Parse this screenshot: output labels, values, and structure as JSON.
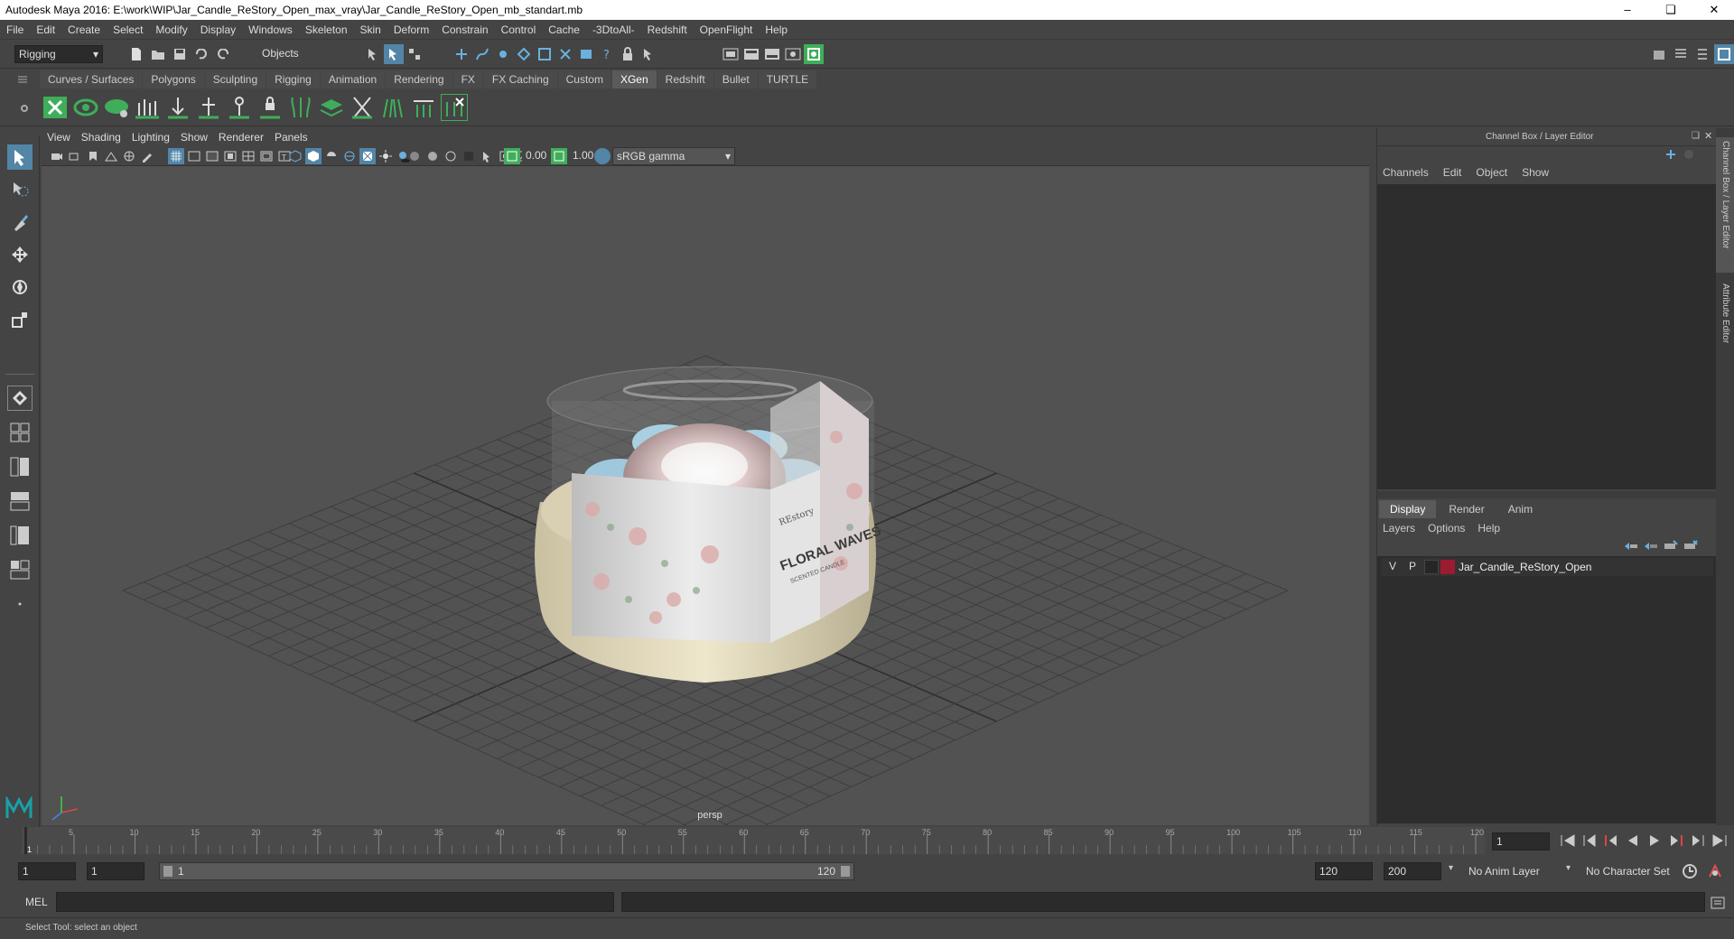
{
  "window": {
    "title": "Autodesk Maya 2016: E:\\work\\WIP\\Jar_Candle_ReStory_Open_max_vray\\Jar_Candle_ReStory_Open_mb_standart.mb"
  },
  "menubar": [
    "File",
    "Edit",
    "Create",
    "Select",
    "Modify",
    "Display",
    "Windows",
    "Skeleton",
    "Skin",
    "Deform",
    "Constrain",
    "Control",
    "Cache",
    "-3DtoAll-",
    "Redshift",
    "OpenFlight",
    "Help"
  ],
  "statusline": {
    "mode": "Rigging",
    "selection_mode": "Objects"
  },
  "shelf_tabs": [
    "Curves / Surfaces",
    "Polygons",
    "Sculpting",
    "Rigging",
    "Animation",
    "Rendering",
    "FX",
    "FX Caching",
    "Custom",
    "XGen",
    "Redshift",
    "Bullet",
    "TURTLE"
  ],
  "active_shelf_tab": "XGen",
  "viewport": {
    "menu": [
      "View",
      "Shading",
      "Lighting",
      "Show",
      "Renderer",
      "Panels"
    ],
    "exposure": "0.00",
    "gamma": "1.00",
    "color_space": "sRGB gamma",
    "camera": "persp",
    "label_brand": "REstory",
    "label_title": "FLORAL WAVES",
    "label_sub": "SCENTED CANDLE"
  },
  "channel_box": {
    "title": "Channel Box / Layer Editor",
    "menu": [
      "Channels",
      "Edit",
      "Object",
      "Show"
    ],
    "layer_tabs": [
      "Display",
      "Render",
      "Anim"
    ],
    "active_layer_tab": "Display",
    "layer_menu": [
      "Layers",
      "Options",
      "Help"
    ],
    "layers": [
      {
        "v": "V",
        "p": "P",
        "name": "Jar_Candle_ReStory_Open",
        "color": "#9b1b30"
      }
    ]
  },
  "side_tabs": [
    "Channel Box / Layer Editor",
    "Attribute Editor"
  ],
  "timeline": {
    "ticks": [
      "1",
      "5",
      "10",
      "15",
      "20",
      "25",
      "30",
      "35",
      "40",
      "45",
      "50",
      "55",
      "60",
      "65",
      "70",
      "75",
      "80",
      "85",
      "90",
      "95",
      "100",
      "105",
      "110",
      "115",
      "120"
    ],
    "current_frame": "1"
  },
  "range": {
    "start": "1",
    "playback_start": "1",
    "slider_start": "1",
    "slider_end": "120",
    "playback_end": "120",
    "end": "200",
    "anim_layer": "No Anim Layer",
    "character_set": "No Character Set"
  },
  "command_line": {
    "label": "MEL"
  },
  "help_line": "Select Tool: select an object",
  "colors": {
    "accent": "#5285a6",
    "viewport_bg": "#525252",
    "panel": "#444444",
    "field": "#2b2b2b",
    "xgen_green": "#3fae5a"
  }
}
